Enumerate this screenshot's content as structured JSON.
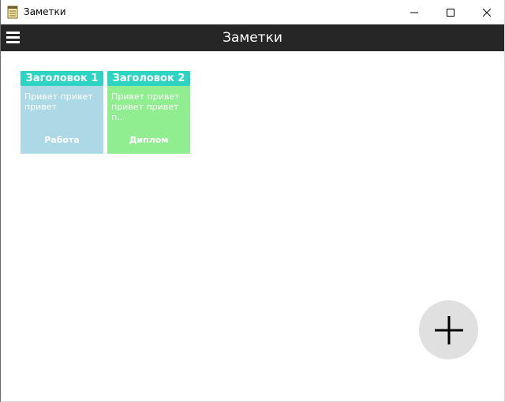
{
  "window": {
    "title": "Заметки",
    "controls": [
      "minimize",
      "maximize",
      "close"
    ]
  },
  "header": {
    "title": "Заметки",
    "menu_icon": "hamburger-menu-icon"
  },
  "notes": [
    {
      "title": "Заголовок 1",
      "body": "Привет привет привет",
      "category": "Работа",
      "title_color": "#2dd4c4",
      "card_color": "#add8e6"
    },
    {
      "title": "Заголовок 2",
      "body": "Привет привет привет привет п..",
      "category": "Диплом",
      "title_color": "#2dd4c4",
      "card_color": "#90ee90"
    }
  ],
  "fab": {
    "icon": "plus-icon",
    "color": "#e0e0e0"
  }
}
